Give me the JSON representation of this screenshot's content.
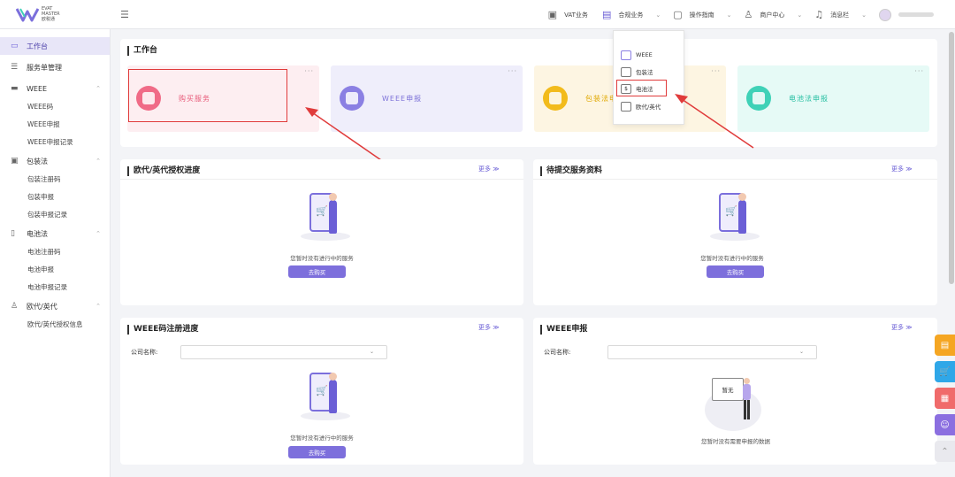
{
  "brand": {
    "logo_line1": "EVAT",
    "logo_line2": "MASTER",
    "logo_line3": "欧税通"
  },
  "topnav": {
    "vat": "VAT业务",
    "compliance": "合规业务",
    "guide": "操作指南",
    "merchant": "商户中心",
    "messages": "消息栏"
  },
  "sidebar": {
    "workbench": "工作台",
    "service_orders": "服务单管理",
    "weee": "WEEE",
    "weee_items": [
      "WEEE码",
      "WEEE申报",
      "WEEE申报记录"
    ],
    "packaging": "包装法",
    "packaging_items": [
      "包装注册码",
      "包装申报",
      "包装申报记录"
    ],
    "battery": "电池法",
    "battery_items": [
      "电池注册码",
      "电池申报",
      "电池申报记录"
    ],
    "rep": "欧代/英代",
    "rep_items": [
      "欧代/英代授权信息"
    ]
  },
  "workbench": {
    "title": "工作台",
    "tiles": [
      {
        "label": "购买服务",
        "color": "#f06b87",
        "bg": "#fdeef1",
        "text_color": "#e85a79"
      },
      {
        "label": "WEEE申报",
        "color": "#8b80e3",
        "bg": "#efeefb",
        "text_color": "#7d72d8"
      },
      {
        "label": "包装法申报",
        "color": "#f2bb1c",
        "bg": "#fdf5e2",
        "text_color": "#e0a800"
      },
      {
        "label": "电池法申报",
        "color": "#3fd1b7",
        "bg": "#e6faf6",
        "text_color": "#27bfa3"
      }
    ],
    "more_dots": "···"
  },
  "dropdown": {
    "items": [
      "WEEE",
      "包装法",
      "电池法",
      "欧代/英代"
    ]
  },
  "panels": {
    "rep_progress": {
      "title": "欧代/英代授权进度",
      "more": "更多 ≫",
      "empty": "您暂时没有进行中的服务",
      "button": "去购买"
    },
    "pending": {
      "title": "待提交服务资料",
      "more": "更多 ≫",
      "empty": "您暂时没有进行中的服务",
      "button": "去购买"
    },
    "weee_reg": {
      "title": "WEEE码注册进度",
      "more": "更多 ≫",
      "company_label": "公司名称:",
      "empty": "您暂时没有进行中的服务",
      "button": "去购买"
    },
    "weee_decl": {
      "title": "WEEE申报",
      "more": "更多 ≫",
      "company_label": "公司名称:",
      "empty": "您暂时没有需要申报的数据",
      "none_sign": "暂无"
    }
  },
  "colors": {
    "accent": "#6b5fd6",
    "highlight_red": "#e03b3b"
  }
}
